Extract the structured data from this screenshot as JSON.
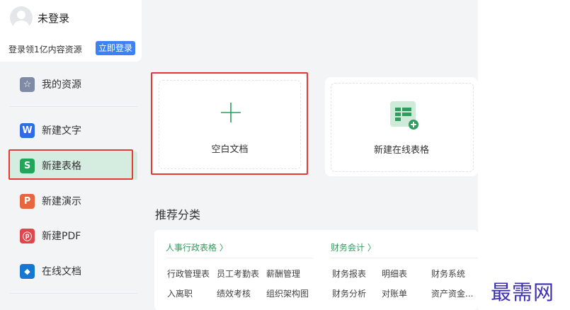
{
  "user": {
    "name": "未登录",
    "promo": "登录领1亿内容资源",
    "login_button": "立即登录"
  },
  "sidebar": {
    "items": [
      {
        "label": "我的资源",
        "icon": "star-icon",
        "color": "#7e8aa6",
        "glyph": "☆"
      },
      {
        "label": "新建文字",
        "icon": "writer-w-icon",
        "color": "#2f6ce5",
        "glyph": "W"
      },
      {
        "label": "新建表格",
        "icon": "spreadsheet-s-icon",
        "color": "#23a55a",
        "glyph": "S"
      },
      {
        "label": "新建演示",
        "icon": "presentation-p-icon",
        "color": "#e8663d",
        "glyph": "P"
      },
      {
        "label": "新建PDF",
        "icon": "pdf-icon",
        "color": "#e0464b",
        "glyph": "ⓟ"
      },
      {
        "label": "在线文档",
        "icon": "cloud-doc-icon",
        "color": "#1677d2",
        "glyph": "◆"
      }
    ],
    "active_index": 2
  },
  "cards": [
    {
      "label": "空白文档",
      "icon": "plus-icon"
    },
    {
      "label": "新建在线表格",
      "icon": "online-sheet-icon"
    }
  ],
  "recommend": {
    "title": "推荐分类",
    "groups": [
      {
        "title": "人事行政表格 〉",
        "items": [
          [
            "行政管理表",
            "员工考勤表",
            "薪酬管理"
          ],
          [
            "入离职",
            "绩效考核",
            "组织架构图"
          ]
        ]
      },
      {
        "title": "财务会计 〉",
        "items": [
          [
            "财务报表",
            "明细表",
            "财务系统"
          ],
          [
            "财务分析",
            "对账单",
            "资产资金..."
          ]
        ]
      }
    ]
  },
  "watermark": "最需网",
  "colors": {
    "accent_green": "#2e9d5d",
    "highlight_red": "#e53935",
    "login_blue": "#3b82f6"
  }
}
